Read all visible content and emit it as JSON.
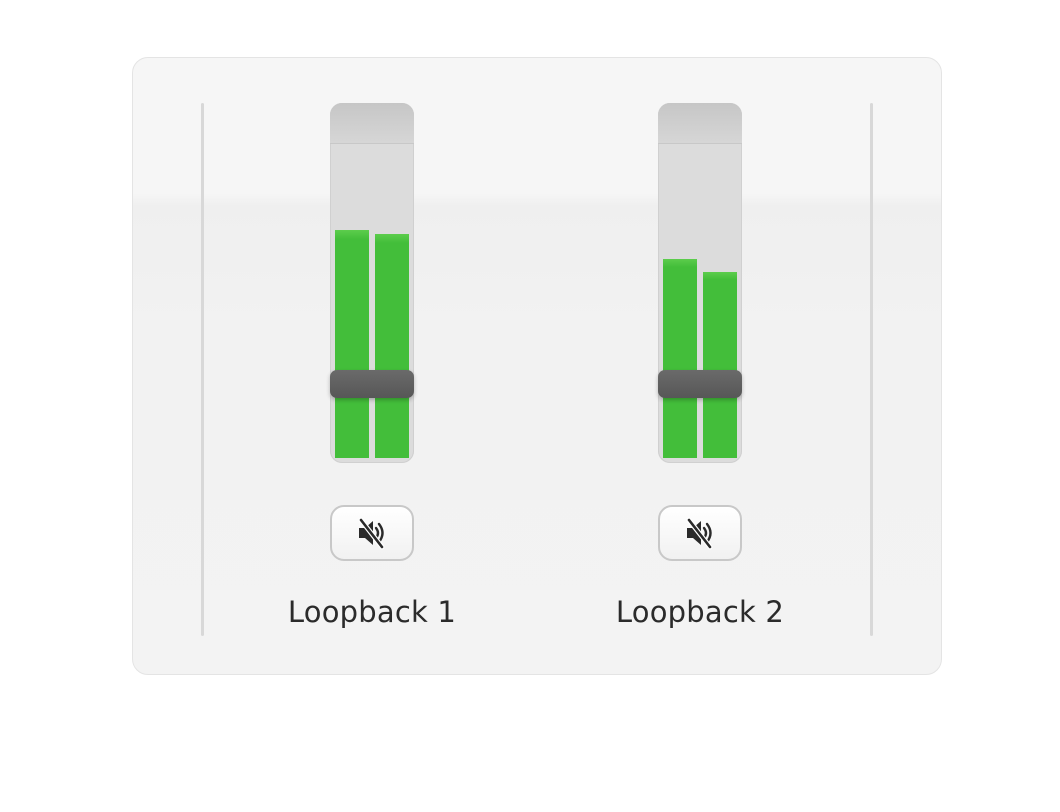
{
  "channels": [
    {
      "label": "Loopback 1",
      "meter_levels": {
        "left": 0.65,
        "right": 0.64
      },
      "fader_level": 0.22,
      "mute_icon": "speaker-muted-icon"
    },
    {
      "label": "Loopback 2",
      "meter_levels": {
        "left": 0.57,
        "right": 0.53
      },
      "fader_level": 0.22,
      "mute_icon": "speaker-muted-icon"
    }
  ],
  "colors": {
    "meter_green": "#43be3a",
    "fader": "#5f5f5f",
    "meter_background": "#dcdcdc"
  }
}
